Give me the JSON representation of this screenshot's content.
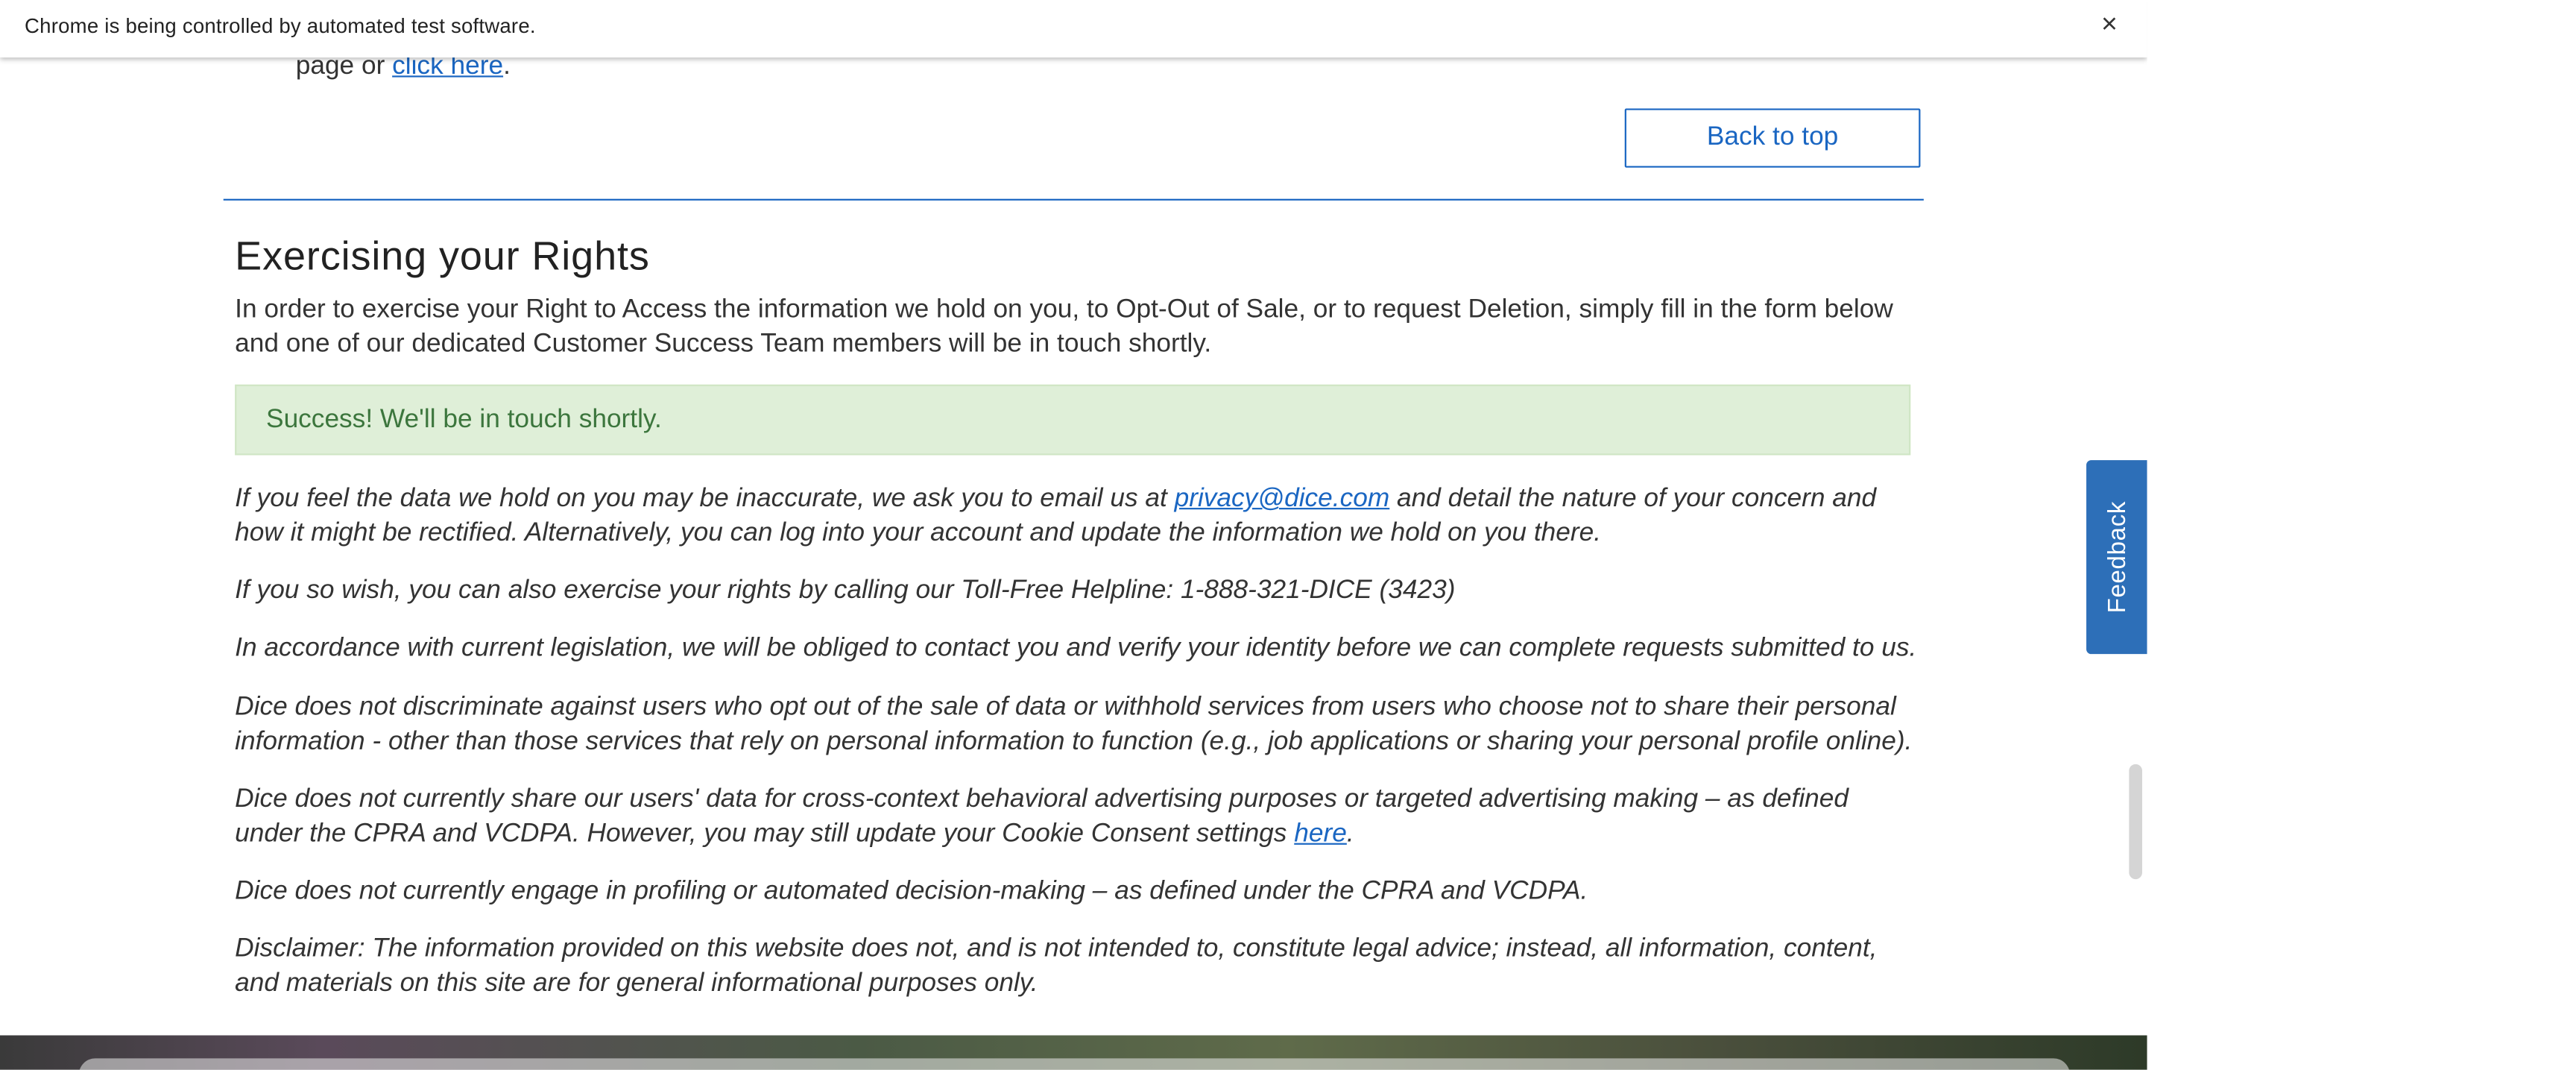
{
  "infobar": {
    "message": "Chrome is being controlled by automated test software.",
    "close_label": "×"
  },
  "previous_section": {
    "text_before": "page or",
    "link_text": "click here",
    "text_after": "."
  },
  "back_to_top_label": "Back to top",
  "rights": {
    "heading": "Exercising your Rights",
    "intro": "In order to exercise your Right to Access the information we hold on you, to Opt-Out of Sale, or to request Deletion, simply fill in the form below and one of our dedicated Customer Success Team members will be in touch shortly.",
    "success_message": "Success! We'll be in touch shortly.",
    "p1_before": "If you feel the data we hold on you may be inaccurate, we ask you to email us at",
    "p1_email": "privacy@dice.com",
    "p1_after": "and detail the nature of your concern and how it might be rectified. Alternatively, you can log into your account and update the information we hold on you there.",
    "p2": "If you so wish, you can also exercise your rights by calling our Toll-Free Helpline: 1-888-321-DICE (3423)",
    "p3": "In accordance with current legislation, we will be obliged to contact you and verify your identity before we can complete requests submitted to us.",
    "p4": "Dice does not discriminate against users who opt out of the sale of data or withhold services from users who choose not to share their personal information - other than those services that rely on personal information to function (e.g., job applications or sharing your personal profile online).",
    "p5_text": "Dice does not currently share our users' data for cross-context behavioral advertising purposes or targeted advertising making – as defined under the CPRA and VCDPA. However, you may still update your Cookie Consent settings",
    "p5_link": "here",
    "p5_after": ".",
    "p6": "Dice does not currently engage in profiling or automated decision-making – as defined under the CPRA and VCDPA.",
    "p7": "Disclaimer: The information provided on this website does not, and is not intended to, constitute legal advice; instead, all information, content, and materials on this site are for general informational purposes only."
  },
  "feedback_label": "Feedback",
  "colors": {
    "link": "#1a66c2",
    "success_bg": "#dfefd8",
    "success_text": "#3c763d",
    "feedback_bg": "#2d6fb8"
  }
}
